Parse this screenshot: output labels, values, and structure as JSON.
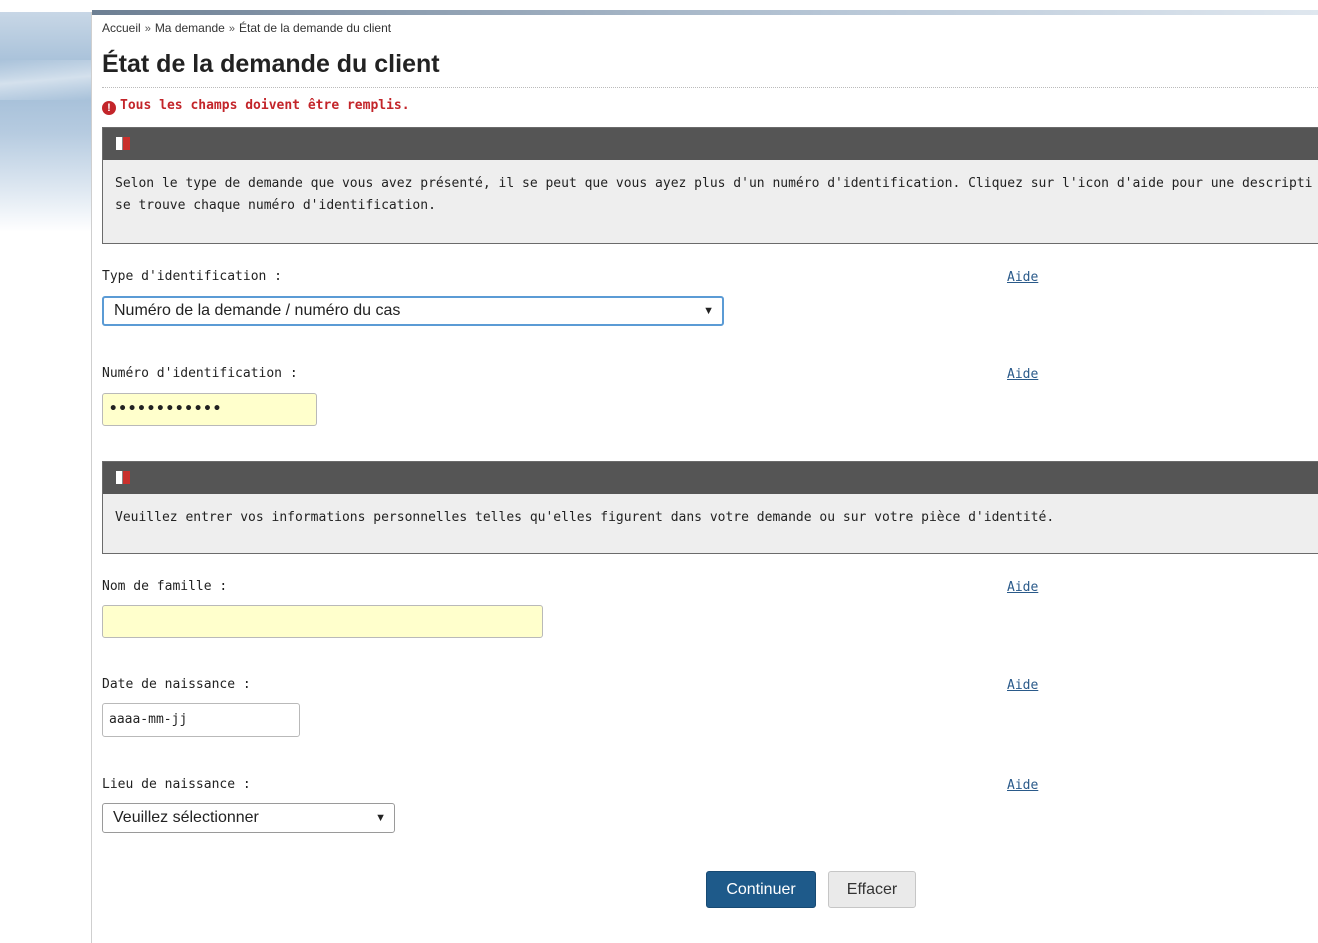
{
  "breadcrumb": {
    "items": [
      "Accueil",
      "Ma demande",
      "État de la demande du client"
    ],
    "separator": "»"
  },
  "page": {
    "title": "État de la demande du client",
    "error": "Tous les champs doivent être remplis.",
    "error_icon": "!"
  },
  "box1": {
    "icon": "book-icon",
    "text_line1": "Selon le type de demande que vous avez présenté, il se peut que vous ayez plus d'un numéro d'identification. Cliquez sur l'icon d'aide pour une descripti",
    "text_line2": "se trouve chaque numéro d'identification."
  },
  "fields": {
    "type_id": {
      "label": "Type d'identification :",
      "value": "Numéro de la demande / numéro du cas",
      "aide": "Aide"
    },
    "num_id": {
      "label": "Numéro d'identification :",
      "value": "••••••••••••",
      "aide": "Aide"
    },
    "nom": {
      "label": "Nom de famille :",
      "value": "",
      "aide": "Aide"
    },
    "date": {
      "label": "Date de naissance :",
      "placeholder": "aaaa-mm-jj",
      "aide": "Aide"
    },
    "lieu": {
      "label": "Lieu de naissance :",
      "value": "Veuillez sélectionner",
      "aide": "Aide"
    }
  },
  "box2": {
    "icon": "book-icon",
    "text": "Veuillez entrer vos informations personnelles telles qu'elles figurent dans votre demande ou sur votre pièce d'identité."
  },
  "buttons": {
    "continue": "Continuer",
    "clear": "Effacer"
  },
  "colors": {
    "error": "#c3252a",
    "primary_button": "#1e5a8a",
    "box_header": "#555555",
    "highlight_input": "#ffffcc",
    "link": "#2a5a8a"
  }
}
